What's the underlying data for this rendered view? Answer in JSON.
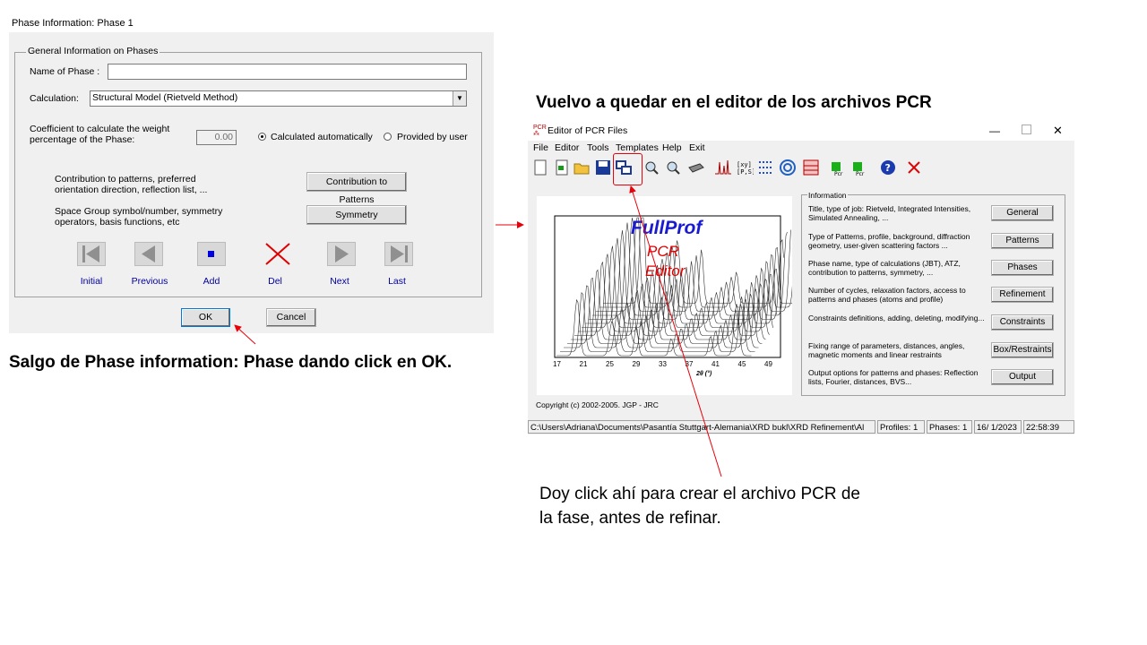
{
  "phase_dialog": {
    "title": "Phase Information: Phase 1",
    "group_title": "General Information on Phases",
    "name_label": "Name of Phase :",
    "name_value": "",
    "calc_label": "Calculation:",
    "calc_value": "Structural Model (Rietveld Method)",
    "coef_label_1": "Coefficient to calculate the weight",
    "coef_label_2": "percentage of the Phase:",
    "coef_value": "0.00",
    "radio_auto": "Calculated automatically",
    "radio_user": "Provided by user",
    "contrib_text_1": "Contribution to patterns, preferred",
    "contrib_text_2": "orientation direction, reflection list, ...",
    "contrib_button": "Contribution to Patterns",
    "sg_text_1": "Space Group symbol/number, symmetry",
    "sg_text_2": "operators, basis functions, etc",
    "sym_button": "Symmetry",
    "nav": [
      "Initial",
      "Previous",
      "Add",
      "Del",
      "Next",
      "Last"
    ],
    "ok": "OK",
    "cancel": "Cancel"
  },
  "annotations": {
    "left_caption": "Salgo de Phase information: Phase dando click en OK.",
    "right_caption": "Vuelvo a quedar en el editor de los archivos PCR",
    "note_line1": "Doy click ahí para crear el archivo PCR de",
    "note_line2": "la fase, antes de refinar."
  },
  "pcr_editor": {
    "title": "Editor of PCR Files",
    "menu": [
      "File",
      "Editor",
      "Tools",
      "Templates",
      "Help",
      "Exit"
    ],
    "splash": {
      "brand": "FullProf",
      "sub1": "PCR",
      "sub2": "Editor",
      "x_ticks": [
        "17",
        "21",
        "25",
        "29",
        "33",
        "37",
        "41",
        "45",
        "49"
      ],
      "x_label": "2θ (°)"
    },
    "copyright": "Copyright (c) 2002-2005. JGP - JRC",
    "info_title": "Information",
    "info": [
      {
        "text": "Title, type of job: Rietveld, Integrated Intensities, Simulated Annealing, ...",
        "button": "General"
      },
      {
        "text": "Type of Patterns, profile, background, diffraction geometry, user-given scattering factors ...",
        "button": "Patterns"
      },
      {
        "text": "Phase name, type of calculations (JBT), ATZ, contribution to patterns, symmetry, ...",
        "button": "Phases"
      },
      {
        "text": "Number of cycles, relaxation factors, access to patterns and phases (atoms and profile)",
        "button": "Refinement"
      },
      {
        "text": "Constraints definitions, adding, deleting, modifying...",
        "button": "Constraints"
      },
      {
        "text": "Fixing range of parameters, distances, angles, magnetic moments and linear restraints",
        "button": "Box/Restraints"
      },
      {
        "text": "Output options for patterns and phases: Reflection lists, Fourier, distances, BVS...",
        "button": "Output"
      }
    ],
    "status": {
      "path": "C:\\Users\\Adriana\\Documents\\Pasantía Stuttgart-Alemania\\XRD bukl\\XRD Refinement\\Al",
      "profiles": "Profiles: 1",
      "phases": "Phases: 1",
      "date": "16/ 1/2023",
      "time": "22:58:39"
    }
  },
  "colors": {
    "annotation_red": "#e8000b",
    "fullprof_blue": "#1a1ad0",
    "splash_red": "#e00000"
  }
}
